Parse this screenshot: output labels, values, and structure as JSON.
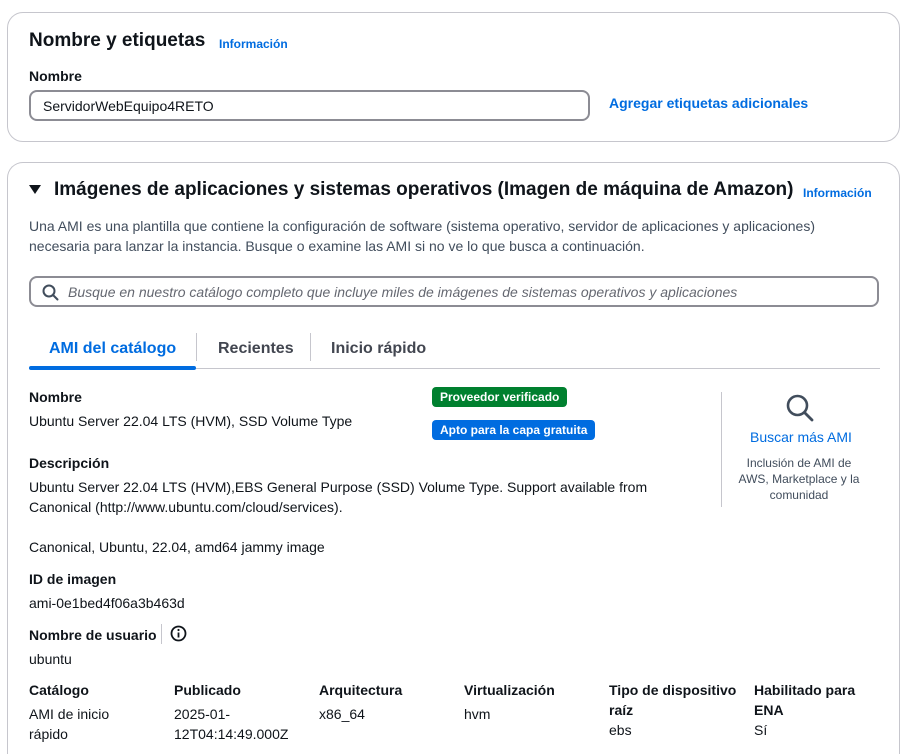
{
  "name_section": {
    "title": "Nombre y etiquetas",
    "info_link": "Información",
    "name_label": "Nombre",
    "name_value": "ServidorWebEquipo4RETO",
    "add_tags_link": "Agregar etiquetas adicionales"
  },
  "ami_section": {
    "title": "Imágenes de aplicaciones y sistemas operativos (Imagen de máquina de Amazon)",
    "info_link": "Información",
    "description_line1": "Una AMI es una plantilla que contiene la configuración de software (sistema operativo, servidor de aplicaciones y aplicaciones)",
    "description_line2": "necesaria para lanzar la instancia. Busque o examine las AMI si no ve lo que busca a continuación.",
    "search_placeholder": "Busque en nuestro catálogo completo que incluye miles de imágenes de sistemas operativos y aplicaciones",
    "tabs": [
      {
        "label": "AMI del catálogo",
        "active": true
      },
      {
        "label": "Recientes",
        "active": false
      },
      {
        "label": "Inicio rápido",
        "active": false
      }
    ],
    "ami": {
      "name_label": "Nombre",
      "name_value": "Ubuntu Server 22.04 LTS (HVM), SSD Volume Type",
      "badge_verified": "Proveedor verificado",
      "badge_free_tier": "Apto para la capa gratuita",
      "description_label": "Descripción",
      "description_line1": "Ubuntu Server 22.04 LTS (HVM),EBS General Purpose (SSD) Volume Type. Support available from",
      "description_line2": "Canonical (http://www.ubuntu.com/cloud/services).",
      "description_line3": "Canonical, Ubuntu, 22.04, amd64 jammy image",
      "image_id_label": "ID de imagen",
      "image_id_value": "ami-0e1bed4f06a3b463d",
      "username_label": "Nombre de usuario",
      "username_value": "ubuntu"
    },
    "search_more": {
      "link": "Buscar más AMI",
      "desc_line1": "Inclusión de AMI de",
      "desc_line2": "AWS, Marketplace y la",
      "desc_line3": "comunidad"
    },
    "details": [
      {
        "label_line1": "Catálogo",
        "label_line2": "",
        "value_line1": "AMI de inicio",
        "value_line2": "rápido"
      },
      {
        "label_line1": "Publicado",
        "label_line2": "",
        "value_line1": "2025-01-",
        "value_line2": "12T04:14:49.000Z"
      },
      {
        "label_line1": "Arquitectura",
        "label_line2": "",
        "value_line1": "x86_64",
        "value_line2": ""
      },
      {
        "label_line1": "Virtualización",
        "label_line2": "",
        "value_line1": "hvm",
        "value_line2": ""
      },
      {
        "label_line1": "Tipo de dispositivo",
        "label_line2": "raíz",
        "value_line1": "ebs",
        "value_line2": ""
      },
      {
        "label_line1": "Habilitado para",
        "label_line2": "ENA",
        "value_line1": "Sí",
        "value_line2": ""
      }
    ]
  },
  "colors": {
    "link_blue": "#006ce0",
    "badge_green": "#00802f",
    "text_dark": "#0f141a",
    "border_gray": "#c6c6cd"
  }
}
